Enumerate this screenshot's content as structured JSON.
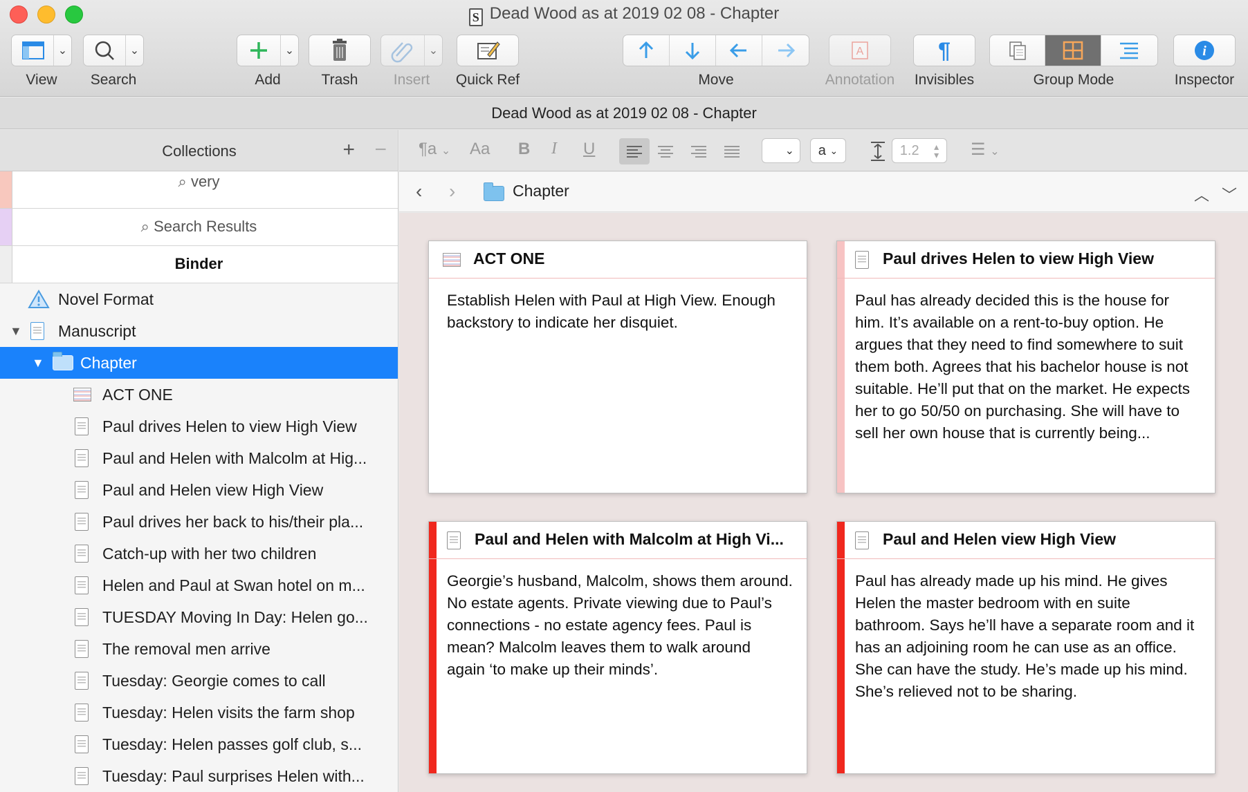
{
  "window": {
    "title": "Dead Wood as at 2019 02 08 - Chapter",
    "app_icon_letter": "S"
  },
  "toolbar": {
    "view": "View",
    "search": "Search",
    "add": "Add",
    "trash": "Trash",
    "insert": "Insert",
    "quick_ref": "Quick Ref",
    "move": "Move",
    "annotation": "Annotation",
    "invisibles": "Invisibles",
    "group_mode": "Group Mode",
    "inspector": "Inspector"
  },
  "doc_header": {
    "title": "Dead Wood as at 2019 02 08 - Chapter"
  },
  "collections": {
    "title": "Collections",
    "tabs": [
      {
        "label": "very",
        "color": "#f8c8be"
      },
      {
        "label": "Search Results",
        "color": "#e6d0f4"
      },
      {
        "label": "Binder",
        "color": "#eeeeee"
      }
    ]
  },
  "binder": {
    "items": [
      {
        "label": "Novel Format",
        "icon": "warning-icon",
        "level": 0
      },
      {
        "label": "Manuscript",
        "icon": "document-icon",
        "level": 0
      },
      {
        "label": "Chapter",
        "icon": "folder-icon",
        "level": 1,
        "selected": true
      },
      {
        "label": "ACT ONE",
        "icon": "act-icon",
        "level": 2
      },
      {
        "label": "Paul drives Helen to view High View",
        "icon": "document-icon",
        "level": 2
      },
      {
        "label": "Paul and Helen with Malcolm at Hig...",
        "icon": "document-icon",
        "level": 2
      },
      {
        "label": "Paul and Helen view High View",
        "icon": "document-icon",
        "level": 2
      },
      {
        "label": "Paul drives her back to his/their pla...",
        "icon": "document-icon",
        "level": 2
      },
      {
        "label": "Catch-up with her two children",
        "icon": "document-icon",
        "level": 2
      },
      {
        "label": "Helen and Paul at Swan hotel on m...",
        "icon": "document-icon",
        "level": 2
      },
      {
        "label": "TUESDAY Moving In Day: Helen go...",
        "icon": "document-icon",
        "level": 2
      },
      {
        "label": "The removal men arrive",
        "icon": "document-icon",
        "level": 2
      },
      {
        "label": "Tuesday: Georgie comes to call",
        "icon": "document-icon",
        "level": 2
      },
      {
        "label": "Tuesday: Helen visits the farm shop",
        "icon": "document-icon",
        "level": 2
      },
      {
        "label": "Tuesday: Helen passes golf club, s...",
        "icon": "document-icon",
        "level": 2
      },
      {
        "label": "Tuesday: Paul surprises Helen with...",
        "icon": "document-icon",
        "level": 2
      }
    ]
  },
  "format_bar": {
    "font_sample": "Aa",
    "bold": "B",
    "italic": "I",
    "underline": "U",
    "text_color": "a",
    "line_spacing": "1.2"
  },
  "nav": {
    "breadcrumb": "Chapter"
  },
  "corkboard": {
    "cards": [
      {
        "title": "ACT ONE",
        "icon": "act-icon",
        "label_color": "#ffffff",
        "synopsis": "Establish Helen with Paul at High View. Enough backstory to indicate her disquiet."
      },
      {
        "title": "Paul drives Helen to view High View",
        "icon": "document-icon",
        "label_color": "#f7c3c3",
        "synopsis": "Paul has already decided this is the house for him. It’s available on a rent-to-buy option. He argues that they need to find somewhere to suit them both. Agrees that his bachelor house is not suitable. He’ll put that on the market. He expects her to go 50/50 on purchasing. She will have to sell her own house that is currently being..."
      },
      {
        "title": "Paul and Helen with Malcolm at High Vi...",
        "icon": "document-icon",
        "label_color": "#f0281e",
        "synopsis": "Georgie’s husband, Malcolm, shows them around. No estate agents. Private viewing due to Paul’s connections - no estate agency fees. Paul is mean? Malcolm leaves them to walk around again ‘to make up their minds’."
      },
      {
        "title": "Paul and Helen view High View",
        "icon": "document-icon",
        "label_color": "#f0281e",
        "synopsis": "Paul has already made up his mind. He gives Helen the master bedroom with en suite bathroom. Says he’ll have a separate room and it has an adjoining room he can use as an office. She can have the study. He’s made up his mind. She’s relieved not to be sharing."
      }
    ]
  },
  "colors": {
    "accent": "#1a82fb",
    "corkboard_bg": "#ebe2e1",
    "add_green": "#2fb65a",
    "move_blue": "#3a9de8"
  }
}
